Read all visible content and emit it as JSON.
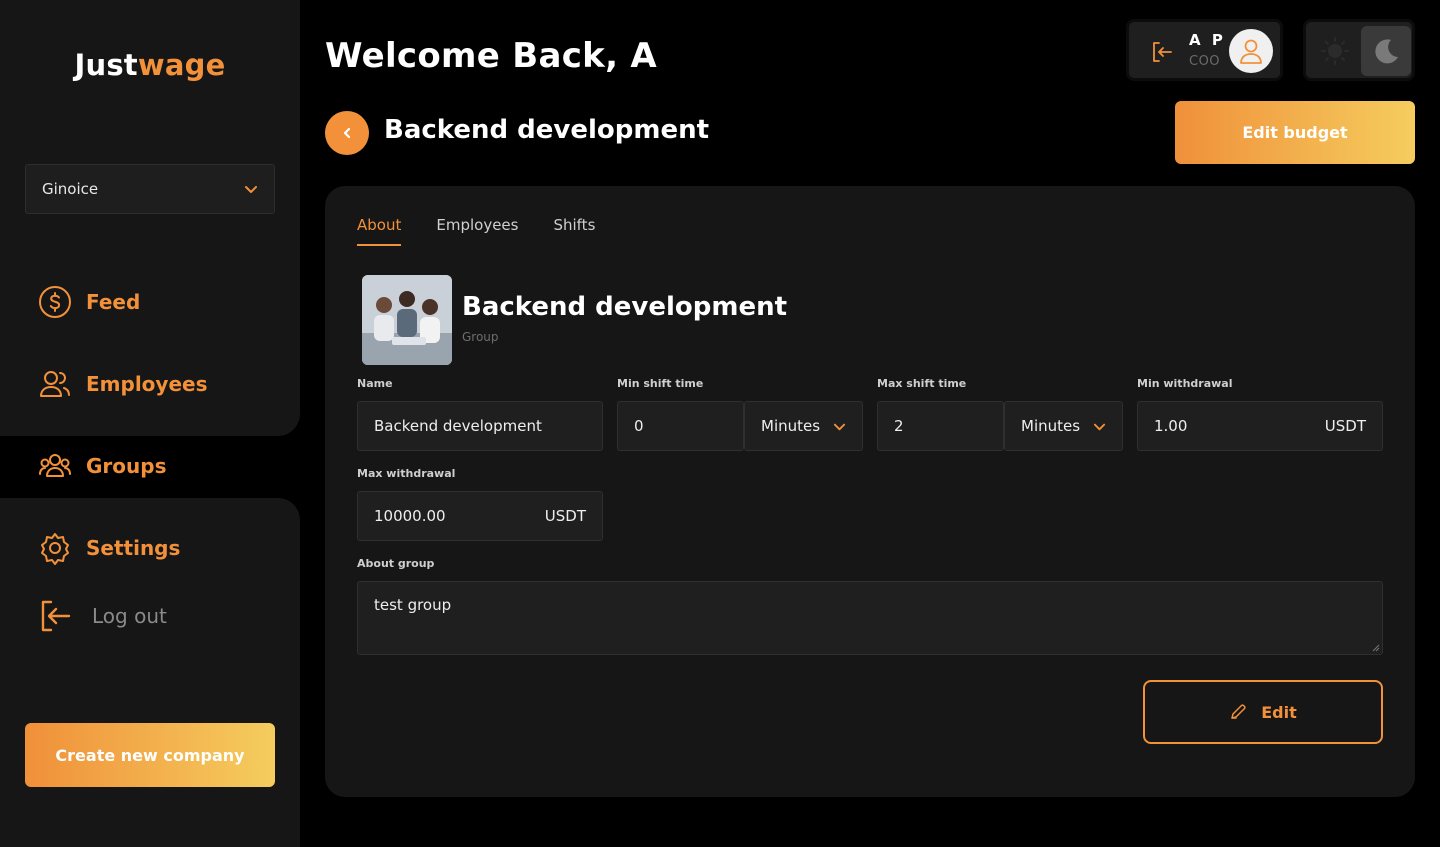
{
  "brand": {
    "part1": "Just",
    "part2": "wage"
  },
  "company_select": {
    "value": "Ginoice"
  },
  "nav": {
    "feed": "Feed",
    "employees": "Employees",
    "groups": "Groups",
    "settings": "Settings",
    "logout": "Log out"
  },
  "create_company_label": "Create new company",
  "header": {
    "welcome": "Welcome Back, A",
    "user_initials": "A P",
    "user_role": "COO"
  },
  "page": {
    "title": "Backend development",
    "edit_budget_label": "Edit budget"
  },
  "tabs": [
    "About",
    "Employees",
    "Shifts"
  ],
  "group": {
    "name": "Backend development",
    "type": "Group"
  },
  "form": {
    "name_label": "Name",
    "name_value": "Backend development",
    "min_shift_label": "Min shift time",
    "min_shift_value": "0",
    "min_shift_unit": "Minutes",
    "max_shift_label": "Max shift time",
    "max_shift_value": "2",
    "max_shift_unit": "Minutes",
    "min_withdrawal_label": "Min withdrawal",
    "min_withdrawal_value": "1.00",
    "min_withdrawal_currency": "USDT",
    "max_withdrawal_label": "Max withdrawal",
    "max_withdrawal_value": "10000.00",
    "max_withdrawal_currency": "USDT",
    "about_label": "About group",
    "about_value": "test group",
    "edit_label": "Edit"
  },
  "colors": {
    "accent": "#f2913a",
    "gradient_end": "#f5cd5e",
    "panel": "#161616",
    "background": "#000000"
  },
  "icons": [
    "dollar-icon",
    "users-icon",
    "group-icon",
    "gear-icon",
    "logout-icon",
    "chevron-down-icon",
    "chevron-left-icon",
    "user-avatar-icon",
    "sun-icon",
    "moon-icon",
    "pencil-icon"
  ]
}
